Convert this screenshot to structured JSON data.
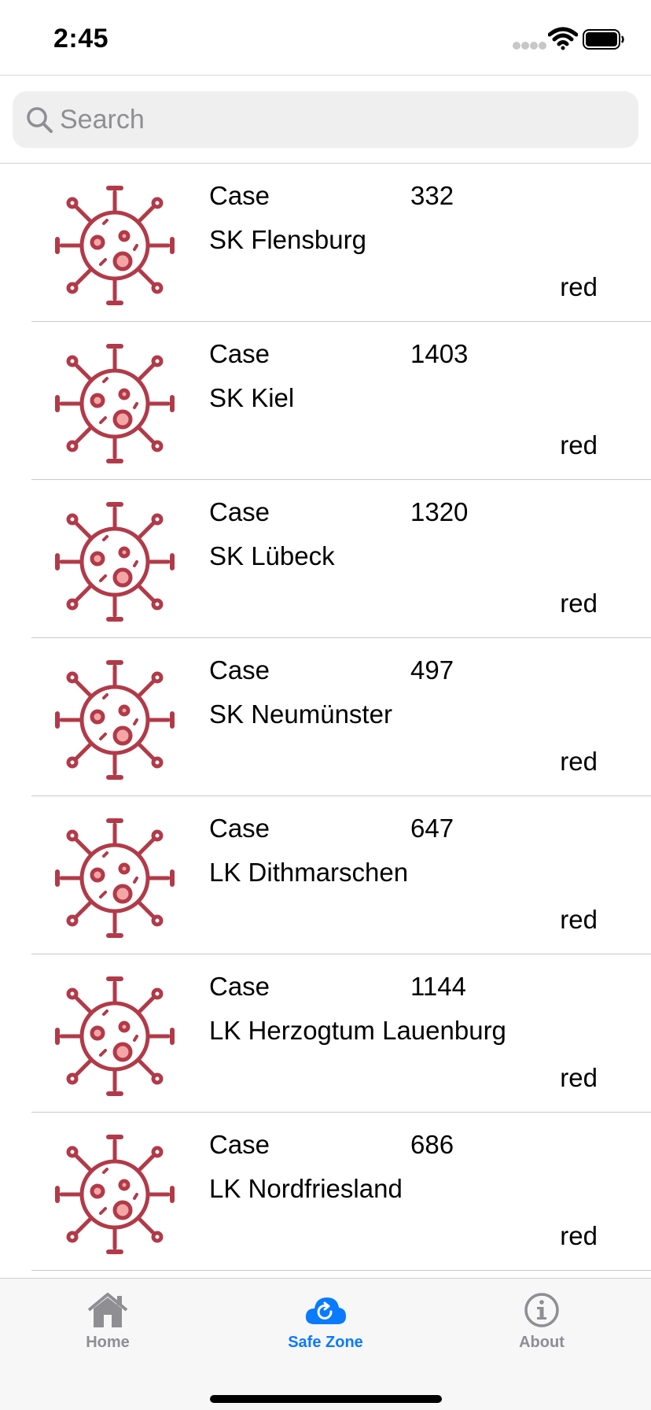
{
  "status_bar": {
    "time": "2:45"
  },
  "search": {
    "placeholder": "Search",
    "value": ""
  },
  "cases": [
    {
      "label": "Case",
      "count": "332",
      "district": "SK Flensburg",
      "status": "red"
    },
    {
      "label": "Case",
      "count": "1403",
      "district": "SK Kiel",
      "status": "red"
    },
    {
      "label": "Case",
      "count": "1320",
      "district": "SK Lübeck",
      "status": "red"
    },
    {
      "label": "Case",
      "count": "497",
      "district": "SK Neumünster",
      "status": "red"
    },
    {
      "label": "Case",
      "count": "647",
      "district": "LK Dithmarschen",
      "status": "red"
    },
    {
      "label": "Case",
      "count": "1144",
      "district": "LK Herzogtum Lauenburg",
      "status": "red"
    },
    {
      "label": "Case",
      "count": "686",
      "district": "LK Nordfriesland",
      "status": "red"
    }
  ],
  "list_icon": "virus-icon",
  "tab_bar": {
    "tabs": [
      {
        "label": "Home",
        "icon": "house-icon",
        "selected": false
      },
      {
        "label": "Safe Zone",
        "icon": "cloud-refresh-icon",
        "selected": true
      },
      {
        "label": "About",
        "icon": "info-icon",
        "selected": false
      }
    ]
  },
  "colors": {
    "virus_stroke": "#b23a48",
    "virus_fill": "#f4a6a6",
    "tab_selected": "#0a7aff",
    "tab_unselected": "#8e8e93",
    "search_background": "#efefef"
  }
}
